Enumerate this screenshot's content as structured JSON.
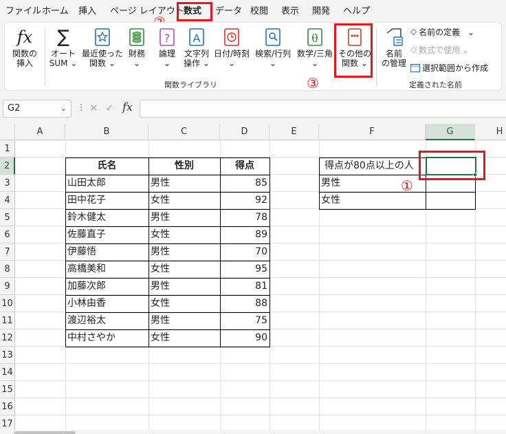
{
  "menu": {
    "tabs": [
      "ファイル",
      "ホーム",
      "挿入",
      "ページ レイアウト",
      "数式",
      "データ",
      "校閲",
      "表示",
      "開発",
      "ヘルプ"
    ],
    "active_tab": "数式"
  },
  "ribbon": {
    "insert_function": [
      "関数の",
      "挿入"
    ],
    "autosum": [
      "オート",
      "SUM"
    ],
    "recent": [
      "最近使った",
      "関数"
    ],
    "financial": [
      "財務"
    ],
    "logical": [
      "論理"
    ],
    "text": [
      "文字列",
      "操作"
    ],
    "datetime": [
      "日付/時刻"
    ],
    "lookup": [
      "検索/行列"
    ],
    "math": [
      "数学/三角"
    ],
    "more": [
      "その他の",
      "関数"
    ],
    "name_manager": [
      "名前",
      "の管理"
    ],
    "define_name": "名前の定義",
    "use_in_formula": "数式で使用",
    "create_from_selection": "選択範囲から作成",
    "group_library": "関数ライブラリ",
    "group_names": "定義された名前",
    "dropdown_caret": "⌄"
  },
  "annotations": {
    "step1": "①",
    "step2": "②",
    "step3": "③"
  },
  "formula_bar": {
    "name_box": "G2",
    "fx": "fx",
    "cancel": "✕",
    "enter": "✓",
    "formula": ""
  },
  "grid": {
    "columns": [
      "A",
      "B",
      "C",
      "D",
      "E",
      "F",
      "G",
      "H"
    ],
    "selected_column": "G",
    "rows": [
      "1",
      "2",
      "3",
      "4",
      "5",
      "6",
      "7",
      "8",
      "9",
      "10",
      "11",
      "12",
      "13",
      "14",
      "15",
      "16",
      "17"
    ],
    "selected_row": "2"
  },
  "table": {
    "headers": [
      "氏名",
      "性別",
      "得点"
    ],
    "rows": [
      [
        "山田太郎",
        "男性",
        "85"
      ],
      [
        "田中花子",
        "女性",
        "92"
      ],
      [
        "鈴木健太",
        "男性",
        "78"
      ],
      [
        "佐藤直子",
        "女性",
        "89"
      ],
      [
        "伊藤悟",
        "男性",
        "70"
      ],
      [
        "高橋美和",
        "女性",
        "95"
      ],
      [
        "加藤次郎",
        "男性",
        "81"
      ],
      [
        "小林由香",
        "女性",
        "88"
      ],
      [
        "渡辺裕太",
        "男性",
        "75"
      ],
      [
        "中村さやか",
        "女性",
        "90"
      ]
    ]
  },
  "summary": {
    "header": "得点が80点以上の人",
    "labels": [
      "男性",
      "女性"
    ],
    "values": [
      "",
      "",
      ""
    ]
  },
  "colors": {
    "accent": "#1e7145",
    "highlight": "#e8141c"
  }
}
